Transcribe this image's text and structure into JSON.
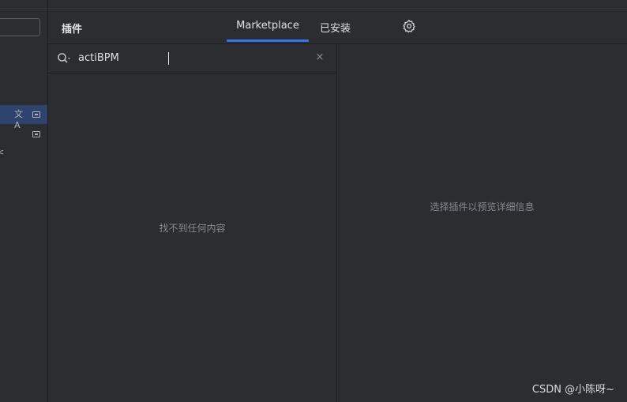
{
  "header": {
    "title": "插件",
    "tabs": [
      {
        "label": "Marketplace",
        "active": true
      },
      {
        "label": "已安装",
        "active": false
      }
    ],
    "settings_icon": "gear-icon"
  },
  "search": {
    "value": "actiBPM",
    "icon": "search-icon",
    "clear_icon": "close-icon",
    "clear_glyph": "×"
  },
  "left_sidebar": {
    "translate_glyph": "文A",
    "fragment_text": "<"
  },
  "results": {
    "empty_text": "找不到任何内容"
  },
  "details": {
    "placeholder_text": "选择插件以预览详细信息"
  },
  "watermark": {
    "text": "CSDN @小陈呀~"
  },
  "colors": {
    "background": "#2b2d30",
    "accent": "#3574f0",
    "selection": "#2e436e",
    "muted_text": "#868a91"
  }
}
